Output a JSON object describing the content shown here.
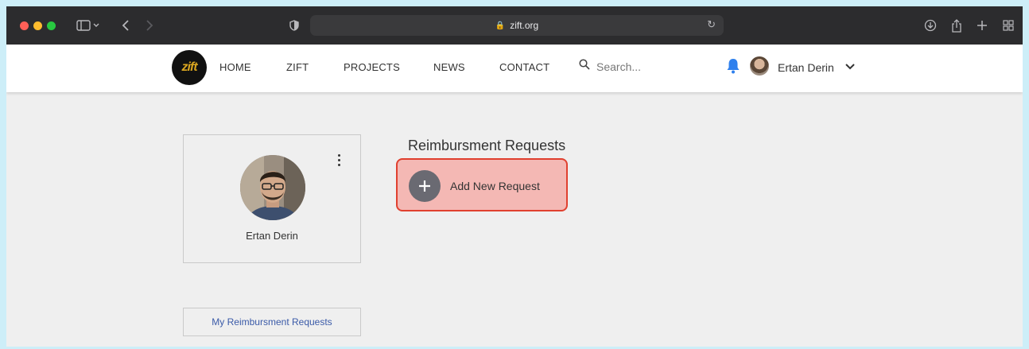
{
  "browser": {
    "url": "zift.org"
  },
  "site": {
    "logo_text": "zift",
    "nav": [
      "HOME",
      "ZIFT",
      "PROJECTS",
      "NEWS",
      "CONTACT"
    ],
    "search_placeholder": "Search...",
    "user_name": "Ertan Derin"
  },
  "profile": {
    "name": "Ertan Derin"
  },
  "main": {
    "section_title": "Reimbursment Requests",
    "add_label": "Add New Request",
    "my_requests_label": "My Reimbursment Requests"
  },
  "colors": {
    "accent_red": "#e0402f",
    "highlight_fill": "#f4b8b4",
    "link_blue": "#3a5aa8",
    "bell_blue": "#2f80ed"
  }
}
